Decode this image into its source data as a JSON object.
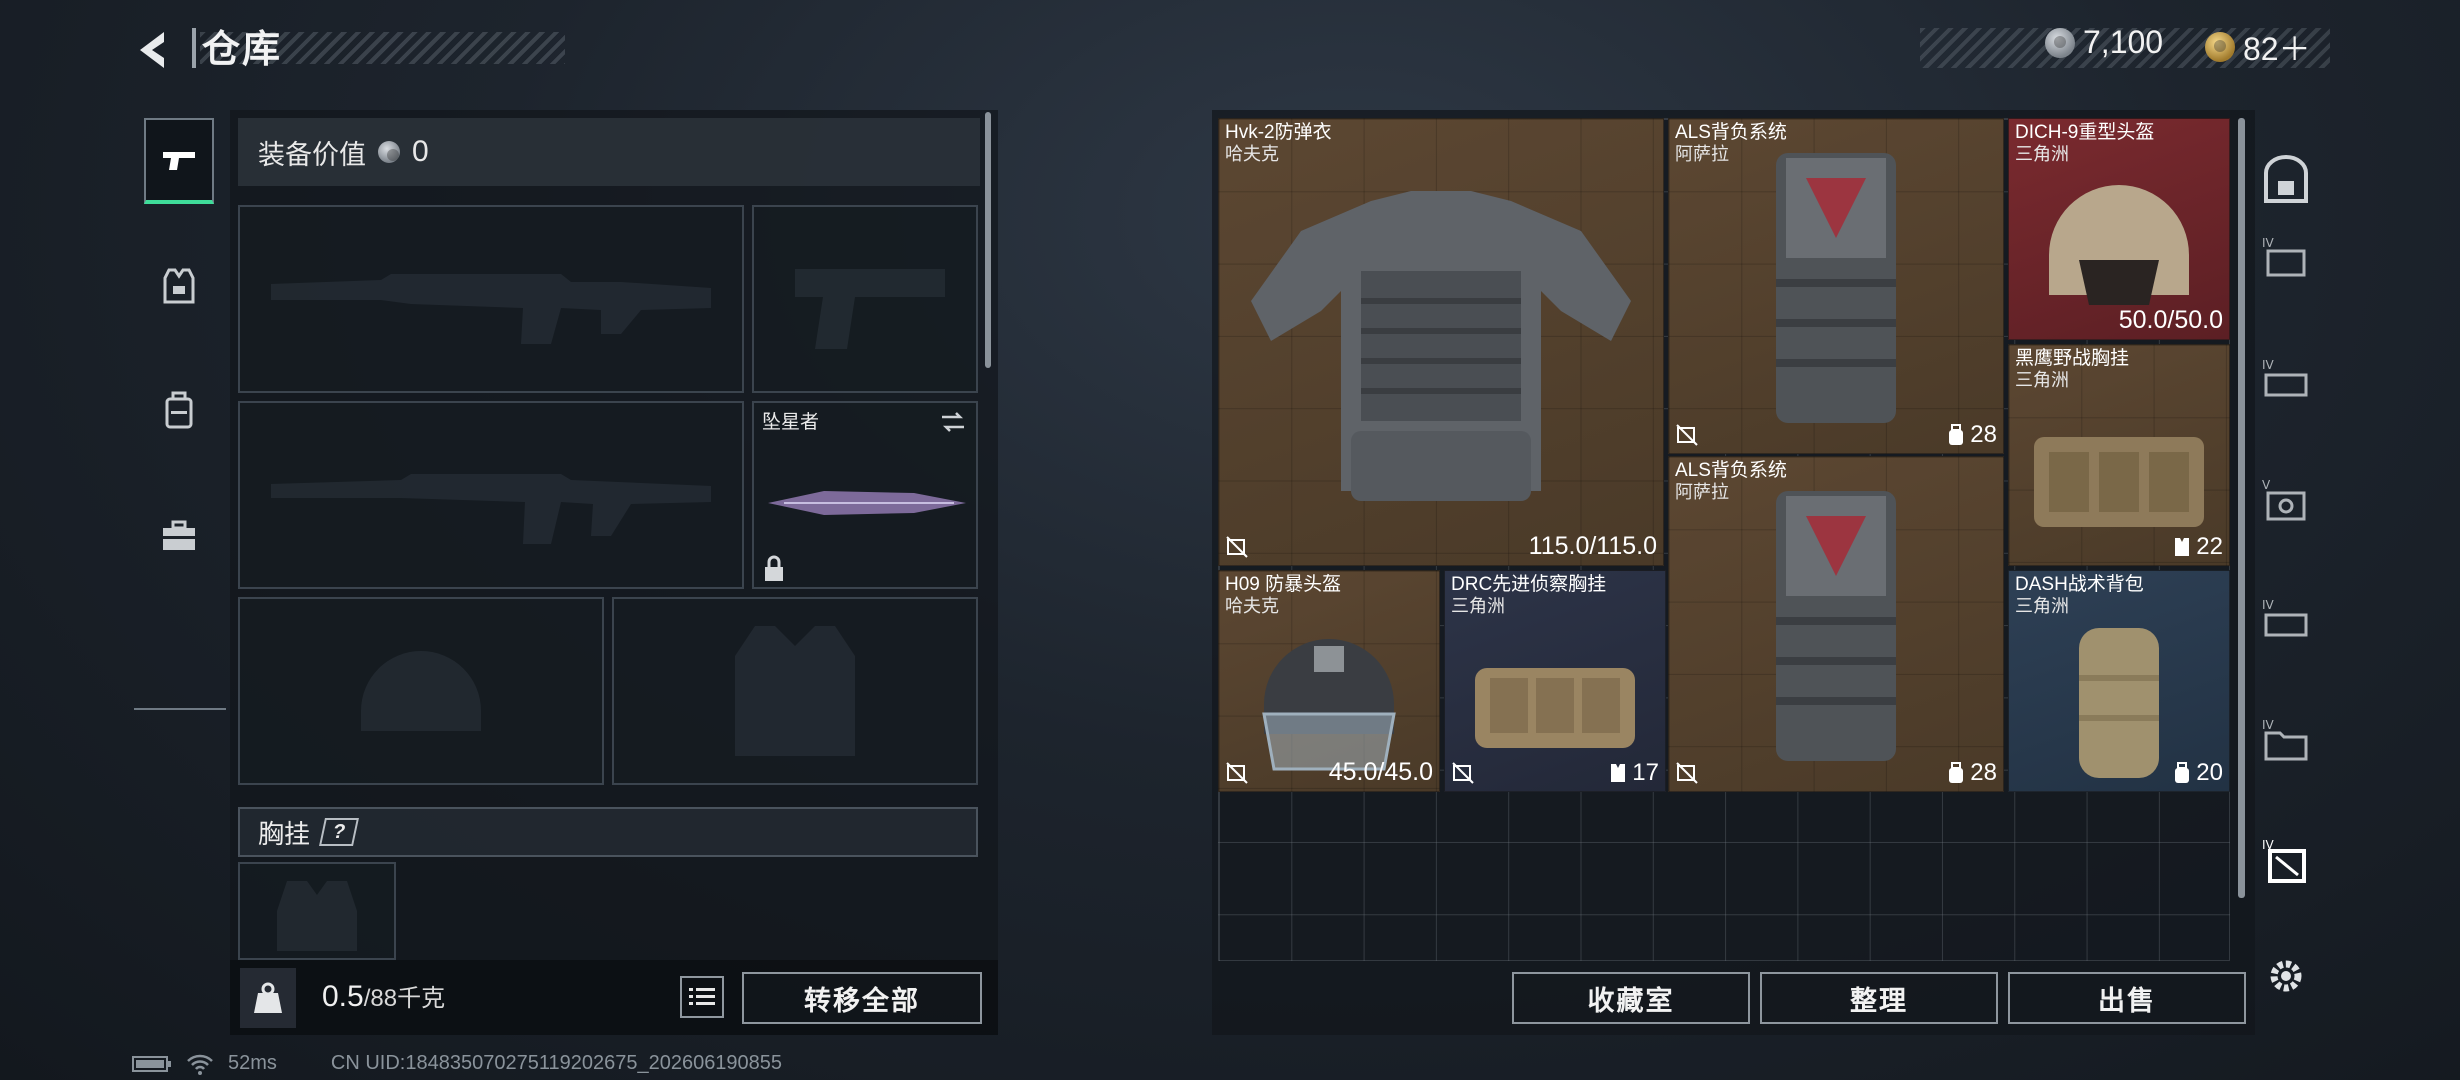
{
  "header": {
    "title": "仓库",
    "currency_silver": "7,100",
    "currency_gold": "82＋"
  },
  "left_panel": {
    "equip_value_label": "装备价值",
    "equip_value": "0",
    "melee_name": "坠星者",
    "chest_rig_label": "胸挂",
    "help_mark": "?",
    "weight_value": "0.5",
    "weight_unit": "/88千克",
    "transfer_all": "转移全部"
  },
  "inventory": {
    "items": [
      {
        "name": "Hvk-2防弹衣",
        "maker": "哈夫克",
        "value": "115.0/115.0"
      },
      {
        "name": "ALS背负系统",
        "maker": "阿萨拉",
        "value": "28"
      },
      {
        "name": "DICH-9重型头盔",
        "maker": "三角洲",
        "value": "50.0/50.0"
      },
      {
        "name": "黑鹰野战胸挂",
        "maker": "三角洲",
        "value": "22"
      },
      {
        "name": "ALS背负系统",
        "maker": "阿萨拉",
        "value": "28"
      },
      {
        "name": "H09 防暴头盔",
        "maker": "哈夫克",
        "value": "45.0/45.0"
      },
      {
        "name": "DRC先进侦察胸挂",
        "maker": "三角洲",
        "value": "17"
      },
      {
        "name": "DASH战术背包",
        "maker": "三角洲",
        "value": "20"
      }
    ],
    "buttons": {
      "collection": "收藏室",
      "organize": "整理",
      "sell": "出售"
    }
  },
  "status_bar": {
    "ping": "52ms",
    "uid": "CN UID:184835070275119202675_202606190855"
  }
}
